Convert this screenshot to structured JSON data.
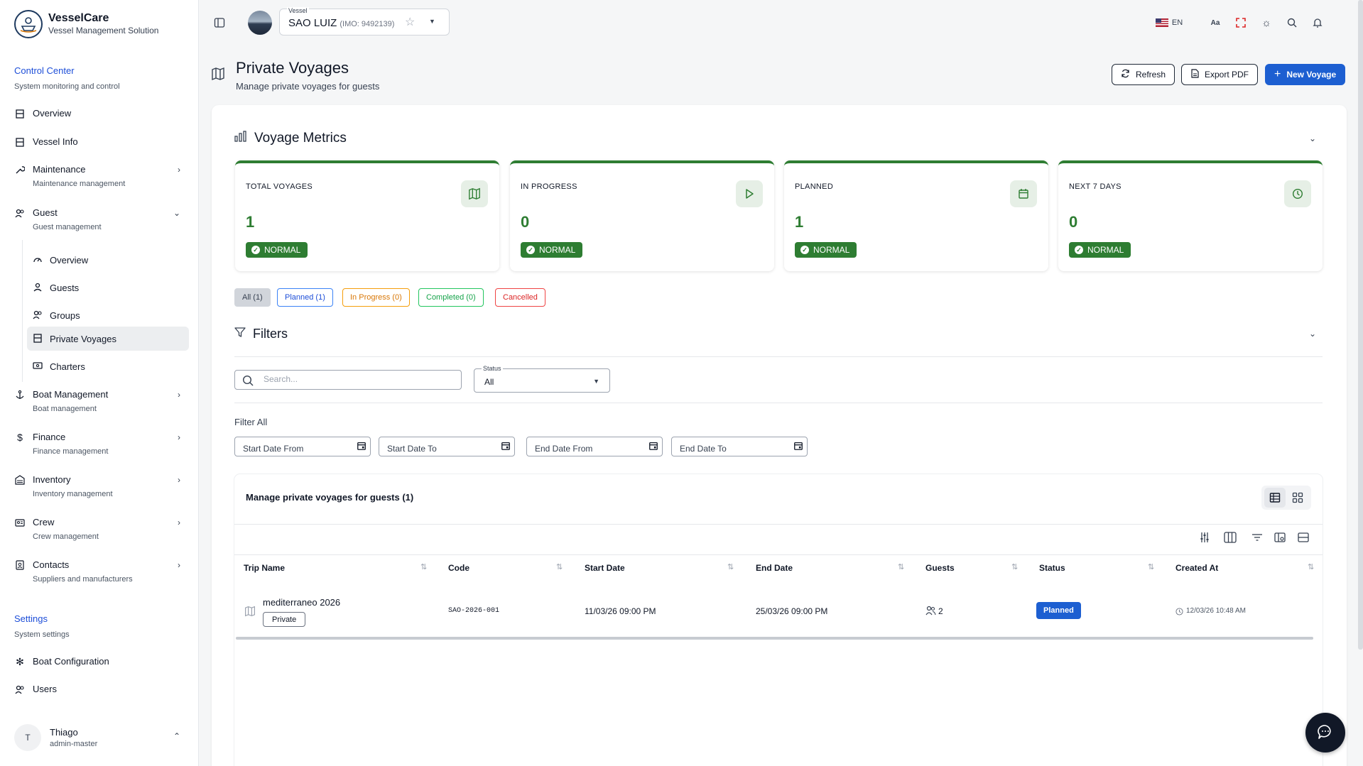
{
  "brand": {
    "title": "VesselCare",
    "subtitle": "Vessel Management Solution"
  },
  "sidebar": {
    "control_center": {
      "title": "Control Center",
      "subtitle": "System monitoring and control"
    },
    "items": [
      {
        "label": "Overview",
        "icon": "building-icon"
      },
      {
        "label": "Vessel Info",
        "icon": "building-icon"
      },
      {
        "label": "Maintenance",
        "sub": "Maintenance management",
        "icon": "wrench-icon"
      },
      {
        "label": "Guest",
        "sub": "Guest management",
        "icon": "users-icon"
      }
    ],
    "guest_sub": [
      {
        "label": "Overview",
        "icon": "gauge-icon"
      },
      {
        "label": "Guests",
        "icon": "user-icon"
      },
      {
        "label": "Groups",
        "icon": "users-icon"
      },
      {
        "label": "Private Voyages",
        "icon": "building-icon"
      },
      {
        "label": "Charters",
        "icon": "ticket-icon"
      }
    ],
    "more_items": [
      {
        "label": "Boat Management",
        "sub": "Boat management",
        "icon": "anchor-icon"
      },
      {
        "label": "Finance",
        "sub": "Finance management",
        "icon": "dollar-icon"
      },
      {
        "label": "Inventory",
        "sub": "Inventory management",
        "icon": "warehouse-icon"
      },
      {
        "label": "Crew",
        "sub": "Crew management",
        "icon": "id-card-icon"
      },
      {
        "label": "Contacts",
        "sub": "Suppliers and manufacturers",
        "icon": "contacts-icon"
      }
    ],
    "settings": {
      "title": "Settings",
      "subtitle": "System settings"
    },
    "settings_items": [
      {
        "label": "Boat Configuration",
        "icon": "cog-icon"
      },
      {
        "label": "Users",
        "icon": "users-icon"
      }
    ],
    "user": {
      "initial": "T",
      "name": "Thiago",
      "role": "admin-master"
    }
  },
  "topbar": {
    "vessel_label": "Vessel",
    "vessel_name": "SAO LUIZ",
    "vessel_imo": "(IMO: 9492139)",
    "language": "EN"
  },
  "page": {
    "title": "Private Voyages",
    "subtitle": "Manage private voyages for guests",
    "buttons": {
      "refresh": "Refresh",
      "export": "Export PDF",
      "new": "New Voyage"
    }
  },
  "metrics": {
    "title": "Voyage Metrics",
    "cards": [
      {
        "label": "TOTAL VOYAGES",
        "value": "1",
        "badge": "NORMAL",
        "icon": "map-icon"
      },
      {
        "label": "IN PROGRESS",
        "value": "0",
        "badge": "NORMAL",
        "icon": "play-icon"
      },
      {
        "label": "PLANNED",
        "value": "1",
        "badge": "NORMAL",
        "icon": "calendar-icon"
      },
      {
        "label": "NEXT 7 DAYS",
        "value": "0",
        "badge": "NORMAL",
        "icon": "clock-icon"
      }
    ],
    "accent": "#2e7d32"
  },
  "chips": {
    "all": "All (1)",
    "planned": "Planned (1)",
    "in_progress": "In Progress (0)",
    "completed": "Completed (0)",
    "cancelled": "Cancelled"
  },
  "filters": {
    "title": "Filters",
    "search_placeholder": "Search...",
    "status_label": "Status",
    "status_value": "All",
    "filter_all": "Filter All",
    "dates": [
      "Start Date From",
      "Start Date To",
      "End Date From",
      "End Date To"
    ]
  },
  "table": {
    "title": "Manage private voyages for guests (1)",
    "columns": [
      "Trip Name",
      "Code",
      "Start Date",
      "End Date",
      "Guests",
      "Status",
      "Created At"
    ],
    "rows": [
      {
        "trip_name": "mediterraneo 2026",
        "tag": "Private",
        "code": "SAO-2026-001",
        "start_date": "11/03/26 09:00 PM",
        "end_date": "25/03/26 09:00 PM",
        "guests": "2",
        "status": "Planned",
        "created_at": "12/03/26 10:48 AM"
      }
    ]
  }
}
